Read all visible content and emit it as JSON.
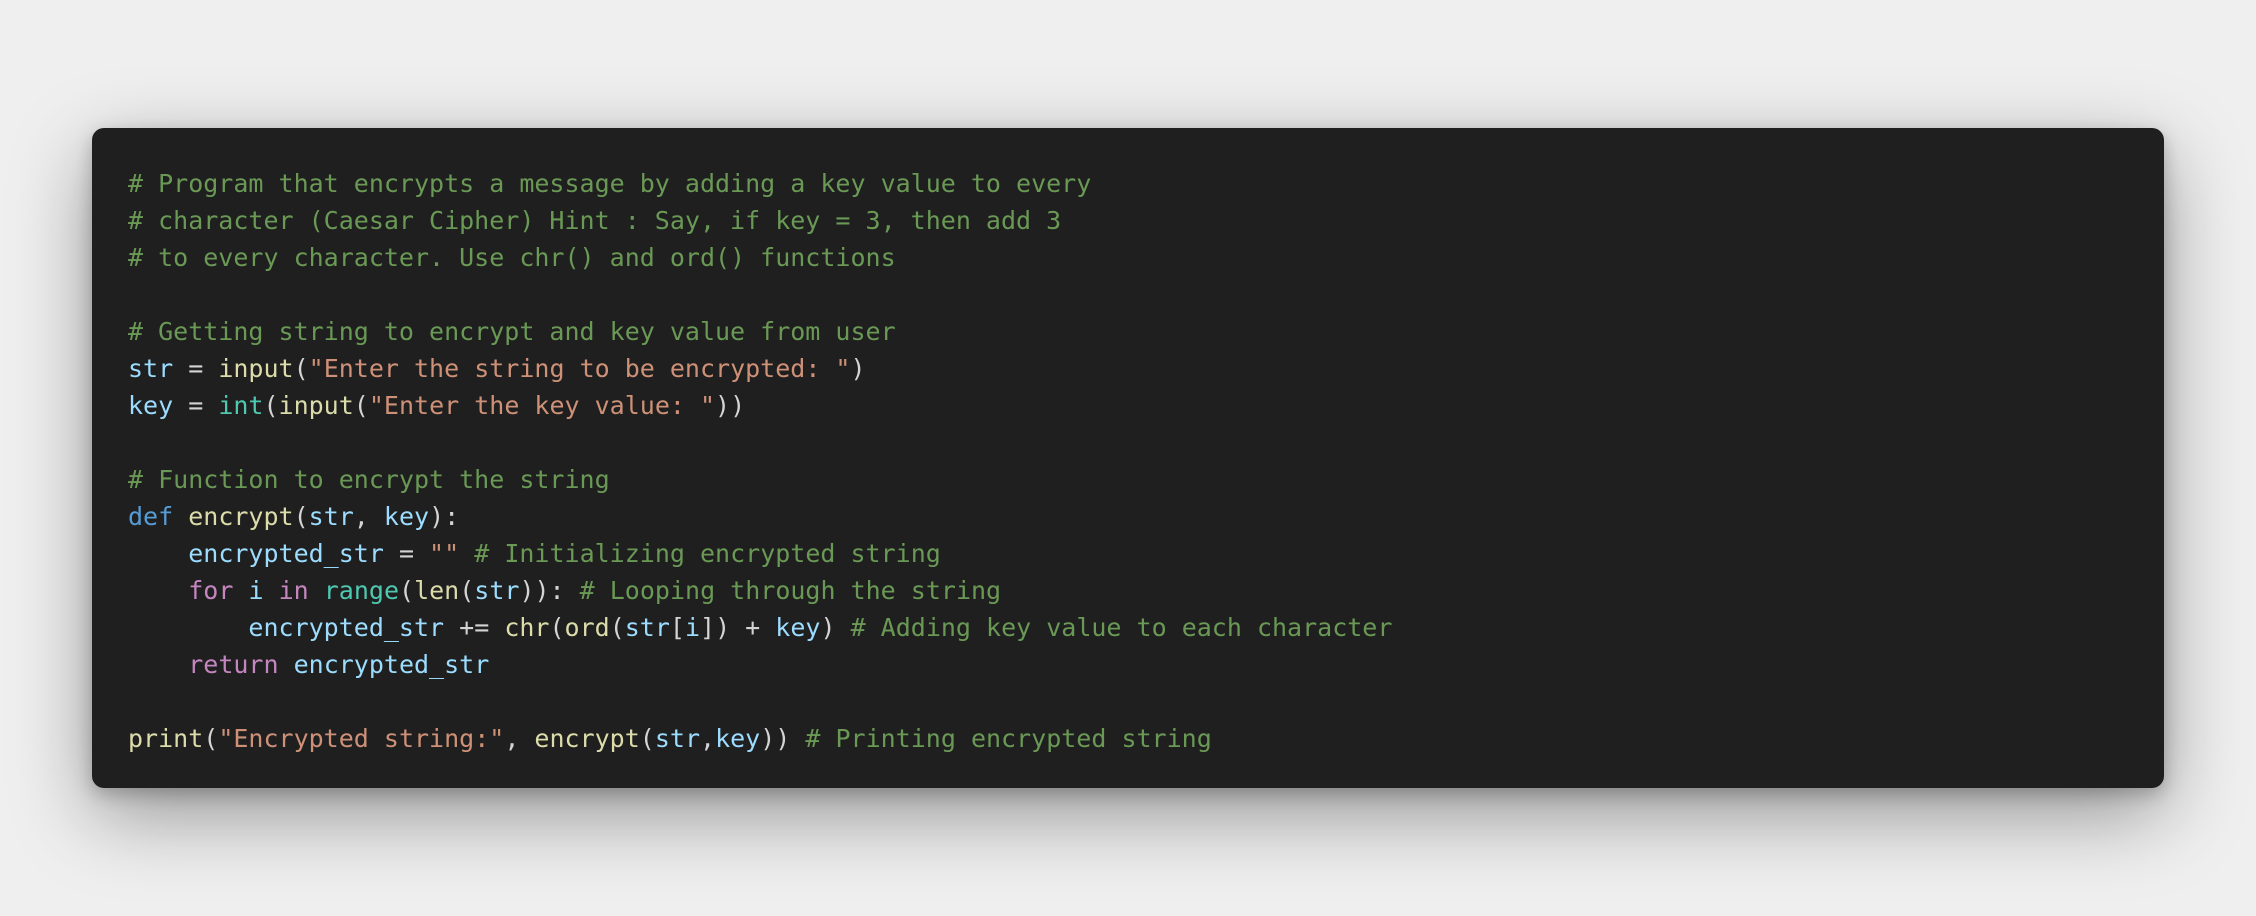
{
  "code": {
    "lines": [
      [
        {
          "t": "# Program that encrypts a message by adding a key value to every",
          "c": "c"
        }
      ],
      [
        {
          "t": "# character (Caesar Cipher) Hint : Say, if key = 3, then add 3",
          "c": "c"
        }
      ],
      [
        {
          "t": "# to every character. Use chr() and ord() functions",
          "c": "c"
        }
      ],
      [],
      [
        {
          "t": "# Getting string to encrypt and key value from user",
          "c": "c"
        }
      ],
      [
        {
          "t": "str",
          "c": "v"
        },
        {
          "t": " = ",
          "c": "o"
        },
        {
          "t": "input",
          "c": "f"
        },
        {
          "t": "(",
          "c": "o"
        },
        {
          "t": "\"Enter the string to be encrypted: \"",
          "c": "s"
        },
        {
          "t": ")",
          "c": "o"
        }
      ],
      [
        {
          "t": "key",
          "c": "v"
        },
        {
          "t": " = ",
          "c": "o"
        },
        {
          "t": "int",
          "c": "t"
        },
        {
          "t": "(",
          "c": "o"
        },
        {
          "t": "input",
          "c": "f"
        },
        {
          "t": "(",
          "c": "o"
        },
        {
          "t": "\"Enter the key value: \"",
          "c": "s"
        },
        {
          "t": "))",
          "c": "o"
        }
      ],
      [],
      [
        {
          "t": "# Function to encrypt the string",
          "c": "c"
        }
      ],
      [
        {
          "t": "def",
          "c": "k"
        },
        {
          "t": " ",
          "c": "o"
        },
        {
          "t": "encrypt",
          "c": "f"
        },
        {
          "t": "(",
          "c": "o"
        },
        {
          "t": "str",
          "c": "v"
        },
        {
          "t": ", ",
          "c": "o"
        },
        {
          "t": "key",
          "c": "v"
        },
        {
          "t": "):",
          "c": "o"
        }
      ],
      [
        {
          "t": "    ",
          "c": "o"
        },
        {
          "t": "encrypted_str",
          "c": "v"
        },
        {
          "t": " = ",
          "c": "o"
        },
        {
          "t": "\"\"",
          "c": "s"
        },
        {
          "t": " ",
          "c": "o"
        },
        {
          "t": "# Initializing encrypted string",
          "c": "c"
        }
      ],
      [
        {
          "t": "    ",
          "c": "o"
        },
        {
          "t": "for",
          "c": "kc"
        },
        {
          "t": " ",
          "c": "o"
        },
        {
          "t": "i",
          "c": "v"
        },
        {
          "t": " ",
          "c": "o"
        },
        {
          "t": "in",
          "c": "kc"
        },
        {
          "t": " ",
          "c": "o"
        },
        {
          "t": "range",
          "c": "t"
        },
        {
          "t": "(",
          "c": "o"
        },
        {
          "t": "len",
          "c": "f"
        },
        {
          "t": "(",
          "c": "o"
        },
        {
          "t": "str",
          "c": "v"
        },
        {
          "t": ")): ",
          "c": "o"
        },
        {
          "t": "# Looping through the string",
          "c": "c"
        }
      ],
      [
        {
          "t": "        ",
          "c": "o"
        },
        {
          "t": "encrypted_str",
          "c": "v"
        },
        {
          "t": " += ",
          "c": "o"
        },
        {
          "t": "chr",
          "c": "f"
        },
        {
          "t": "(",
          "c": "o"
        },
        {
          "t": "ord",
          "c": "f"
        },
        {
          "t": "(",
          "c": "o"
        },
        {
          "t": "str",
          "c": "v"
        },
        {
          "t": "[",
          "c": "o"
        },
        {
          "t": "i",
          "c": "v"
        },
        {
          "t": "]) + ",
          "c": "o"
        },
        {
          "t": "key",
          "c": "v"
        },
        {
          "t": ") ",
          "c": "o"
        },
        {
          "t": "# Adding key value to each character",
          "c": "c"
        }
      ],
      [
        {
          "t": "    ",
          "c": "o"
        },
        {
          "t": "return",
          "c": "kc"
        },
        {
          "t": " ",
          "c": "o"
        },
        {
          "t": "encrypted_str",
          "c": "v"
        }
      ],
      [],
      [
        {
          "t": "print",
          "c": "f"
        },
        {
          "t": "(",
          "c": "o"
        },
        {
          "t": "\"Encrypted string:\"",
          "c": "s"
        },
        {
          "t": ", ",
          "c": "o"
        },
        {
          "t": "encrypt",
          "c": "f"
        },
        {
          "t": "(",
          "c": "o"
        },
        {
          "t": "str",
          "c": "v"
        },
        {
          "t": ",",
          "c": "o"
        },
        {
          "t": "key",
          "c": "v"
        },
        {
          "t": ")) ",
          "c": "o"
        },
        {
          "t": "# Printing encrypted string",
          "c": "c"
        }
      ]
    ]
  }
}
